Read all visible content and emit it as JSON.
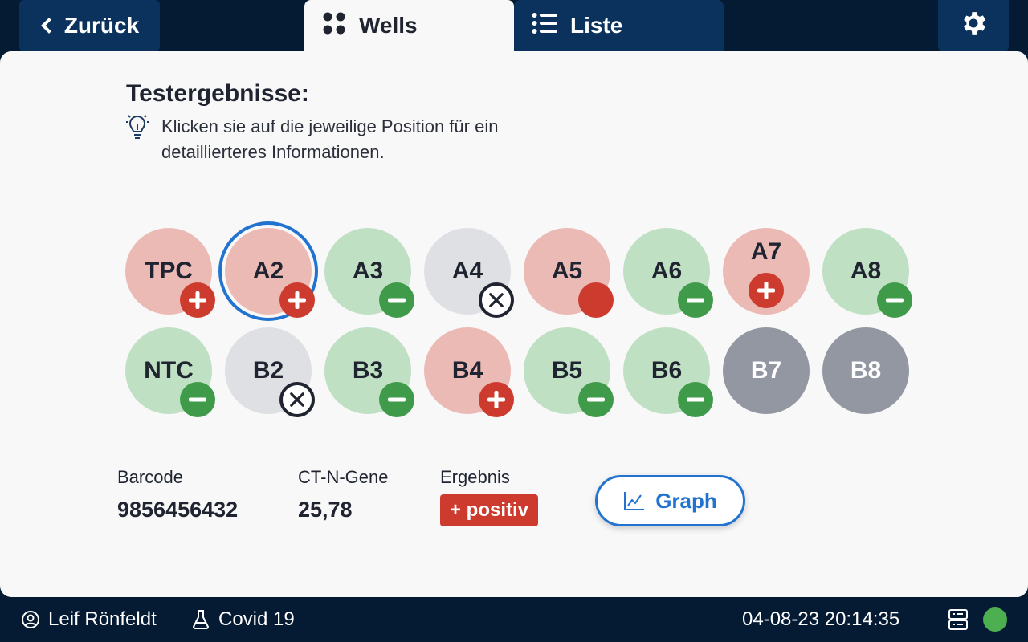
{
  "header": {
    "back_label": "Zurück",
    "tabs": [
      {
        "label": "Wells",
        "icon": "dots-grid-icon",
        "active": true
      },
      {
        "label": "Liste",
        "icon": "list-icon",
        "active": false
      }
    ],
    "settings_icon": "gear-icon"
  },
  "main": {
    "title": "Testergebnisse:",
    "hint": "Klicken sie auf die jeweilige Position für ein detaillierteres Informationen.",
    "hint_icon": "lightbulb-icon",
    "wells": [
      {
        "label": "TPC",
        "state": "pos",
        "badge": "plus"
      },
      {
        "label": "A2",
        "state": "pos",
        "badge": "plus",
        "selected": true
      },
      {
        "label": "A3",
        "state": "neg",
        "badge": "minus"
      },
      {
        "label": "A4",
        "state": "inv",
        "badge": "x"
      },
      {
        "label": "A5",
        "state": "pos",
        "badge": "dot"
      },
      {
        "label": "A6",
        "state": "neg",
        "badge": "minus"
      },
      {
        "label": "A7",
        "state": "pos",
        "badge": "plus-center"
      },
      {
        "label": "A8",
        "state": "neg",
        "badge": "minus"
      },
      {
        "label": "NTC",
        "state": "neg",
        "badge": "minus"
      },
      {
        "label": "B2",
        "state": "inv",
        "badge": "x"
      },
      {
        "label": "B3",
        "state": "neg",
        "badge": "minus"
      },
      {
        "label": "B4",
        "state": "pos",
        "badge": "plus"
      },
      {
        "label": "B5",
        "state": "neg",
        "badge": "minus"
      },
      {
        "label": "B6",
        "state": "neg",
        "badge": "minus"
      },
      {
        "label": "B7",
        "state": "empty",
        "badge": "none"
      },
      {
        "label": "B8",
        "state": "empty",
        "badge": "none"
      }
    ],
    "details": {
      "barcode_label": "Barcode",
      "barcode_value": "9856456432",
      "ct_label": "CT-N-Gene",
      "ct_value": "25,78",
      "result_label": "Ergebnis",
      "result_value": "+ positiv"
    },
    "graph_button": "Graph"
  },
  "footer": {
    "user": "Leif Rönfeldt",
    "test": "Covid 19",
    "datetime": "04-08-23 20:14:35",
    "status_color": "#4caf50"
  },
  "colors": {
    "accent": "#2273d0",
    "positive": "#cc3b2d",
    "negative": "#3f9b4a",
    "dark_bar": "#0b325c"
  }
}
